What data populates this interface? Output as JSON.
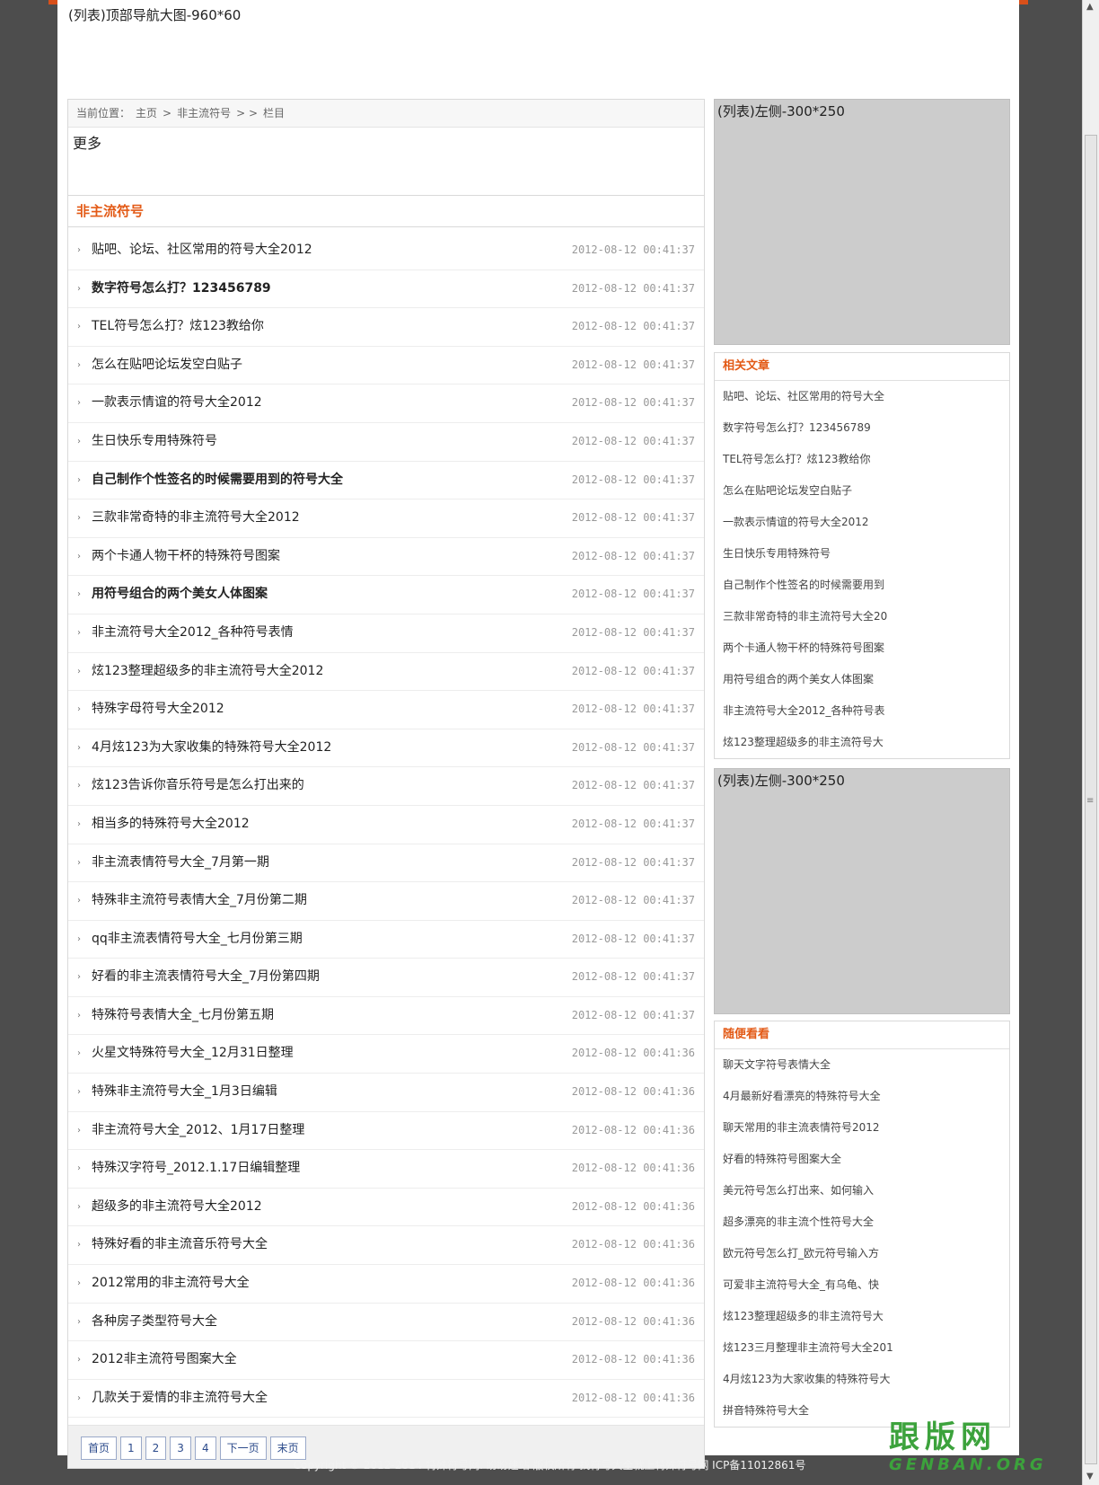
{
  "top_ad": "(列表)顶部导航大图-960*60",
  "breadcrumb": {
    "prefix": "当前位置：",
    "home": "主页",
    "sep1": ">",
    "category": "非主流符号",
    "sep2": "> >",
    "current": "栏目"
  },
  "more_label": "更多",
  "section_title": "非主流符号",
  "articles": [
    {
      "title": "贴吧、论坛、社区常用的符号大全2012",
      "date": "2012-08-12 00:41:37"
    },
    {
      "title": "数字符号怎么打？123456789",
      "date": "2012-08-12 00:41:37"
    },
    {
      "title": "TEL符号怎么打？炫123教给你",
      "date": "2012-08-12 00:41:37"
    },
    {
      "title": "怎么在贴吧论坛发空白贴子",
      "date": "2012-08-12 00:41:37"
    },
    {
      "title": "一款表示情谊的符号大全2012",
      "date": "2012-08-12 00:41:37"
    },
    {
      "title": "生日快乐专用特殊符号",
      "date": "2012-08-12 00:41:37"
    },
    {
      "title": "自己制作个性签名的时候需要用到的符号大全",
      "date": "2012-08-12 00:41:37"
    },
    {
      "title": "三款非常奇特的非主流符号大全2012",
      "date": "2012-08-12 00:41:37"
    },
    {
      "title": "两个卡通人物干杯的特殊符号图案",
      "date": "2012-08-12 00:41:37"
    },
    {
      "title": "用符号组合的两个美女人体图案",
      "date": "2012-08-12 00:41:37"
    },
    {
      "title": "非主流符号大全2012_各种符号表情",
      "date": "2012-08-12 00:41:37"
    },
    {
      "title": "炫123整理超级多的非主流符号大全2012",
      "date": "2012-08-12 00:41:37"
    },
    {
      "title": "特殊字母符号大全2012",
      "date": "2012-08-12 00:41:37"
    },
    {
      "title": "4月炫123为大家收集的特殊符号大全2012",
      "date": "2012-08-12 00:41:37"
    },
    {
      "title": "炫123告诉你音乐符号是怎么打出来的",
      "date": "2012-08-12 00:41:37"
    },
    {
      "title": "相当多的特殊符号大全2012",
      "date": "2012-08-12 00:41:37"
    },
    {
      "title": "非主流表情符号大全_7月第一期",
      "date": "2012-08-12 00:41:37"
    },
    {
      "title": "特殊非主流符号表情大全_7月份第二期",
      "date": "2012-08-12 00:41:37"
    },
    {
      "title": "qq非主流表情符号大全_七月份第三期",
      "date": "2012-08-12 00:41:37"
    },
    {
      "title": "好看的非主流表情符号大全_7月份第四期",
      "date": "2012-08-12 00:41:37"
    },
    {
      "title": "特殊符号表情大全_七月份第五期",
      "date": "2012-08-12 00:41:37"
    },
    {
      "title": "火星文特殊符号大全_12月31日整理",
      "date": "2012-08-12 00:41:36"
    },
    {
      "title": "特殊非主流符号大全_1月3日编辑",
      "date": "2012-08-12 00:41:36"
    },
    {
      "title": "非主流符号大全_2012、1月17日整理",
      "date": "2012-08-12 00:41:36"
    },
    {
      "title": "特殊汉字符号_2012.1.17日编辑整理",
      "date": "2012-08-12 00:41:36"
    },
    {
      "title": "超级多的非主流符号大全2012",
      "date": "2012-08-12 00:41:36"
    },
    {
      "title": "特殊好看的非主流音乐符号大全",
      "date": "2012-08-12 00:41:36"
    },
    {
      "title": "2012常用的非主流符号大全",
      "date": "2012-08-12 00:41:36"
    },
    {
      "title": "各种房子类型符号大全",
      "date": "2012-08-12 00:41:36"
    },
    {
      "title": "2012非主流符号图案大全",
      "date": "2012-08-12 00:41:36"
    },
    {
      "title": "几款关于爱情的非主流符号大全",
      "date": "2012-08-12 00:41:36"
    }
  ],
  "pager": {
    "first": "首页",
    "p1": "1",
    "p2": "2",
    "p3": "3",
    "p4": "4",
    "next": "下一页",
    "last": "末页"
  },
  "side_ad_1": "(列表)左侧-300*250",
  "side_ad_2": "(列表)左侧-300*250",
  "related": {
    "title": "相关文章",
    "items": [
      "贴吧、论坛、社区常用的符号大全",
      "数字符号怎么打？123456789",
      "TEL符号怎么打？炫123教给你",
      "怎么在贴吧论坛发空白贴子",
      "一款表示情谊的符号大全2012",
      "生日快乐专用特殊符号",
      "自己制作个性签名的时候需要用到",
      "三款非常奇特的非主流符号大全20",
      "两个卡通人物干杯的特殊符号图案",
      "用符号组合的两个美女人体图案",
      "非主流符号大全2012_各种符号表",
      "炫123整理超级多的非主流符号大"
    ]
  },
  "random": {
    "title": "随便看看",
    "items": [
      "聊天文字符号表情大全",
      "4月最新好看漂亮的特殊符号大全",
      "聊天常用的非主流表情符号2012",
      "好看的特殊符号图案大全",
      "美元符号怎么打出来、如何输入",
      "超多漂亮的非主流个性符号大全",
      "欧元符号怎么打_欧元符号输入方",
      "可爱非主流符号大全_有乌龟、快",
      "炫123整理超级多的非主流符号大",
      "炫123三月整理非主流符号大全201",
      "4月炫123为大家收集的特殊符号大",
      "拼音特殊符号大全"
    ]
  },
  "footer": "Copyright © 2012-2014 特殊符号网. 盼盼建站 版权所有 找符号大全就上特殊符号网 ICP备11012861号",
  "watermark": {
    "line1": "跟版网",
    "line2": "GENBAN.ORG"
  },
  "bold_rows": [
    1,
    6,
    9
  ]
}
